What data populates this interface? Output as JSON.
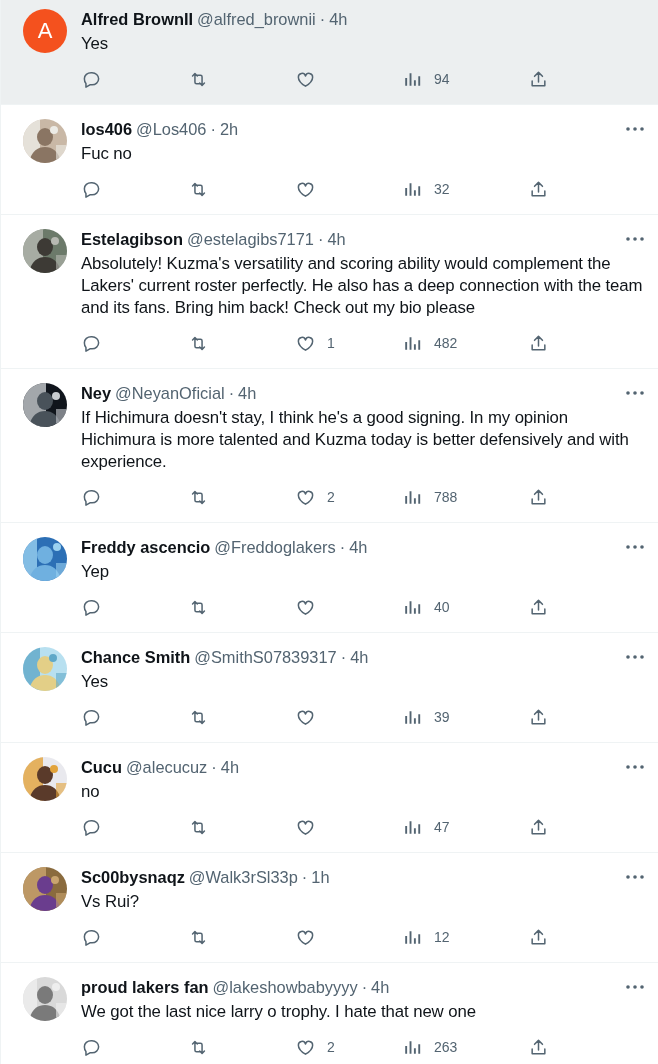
{
  "replies": [
    {
      "avatar": {
        "kind": "letter",
        "letter": "A"
      },
      "name": "Alfred BrownII",
      "handle": "@alfred_brownii",
      "separator": "·",
      "time": "4h",
      "text": "Yes",
      "views": "94",
      "highlighted": true,
      "menu": false
    },
    {
      "name": "los406",
      "handle": "@Los406",
      "separator": "·",
      "time": "2h",
      "text": "Fuc no",
      "views": "32",
      "highlighted": false,
      "menu": true
    },
    {
      "name": "Estelagibson",
      "handle": "@estelagibs7171",
      "separator": "·",
      "time": "4h",
      "text": "Absolutely! Kuzma's versatility and scoring ability would complement the Lakers' current roster perfectly. He also has a deep connection with the team and its fans. Bring him back! Check out my bio please",
      "likes": "1",
      "views": "482",
      "highlighted": false,
      "menu": true
    },
    {
      "name": "Ney",
      "handle": "@NeyanOficial",
      "separator": "·",
      "time": "4h",
      "text": "If Hichimura doesn't stay, I think he's a good signing. In my opinion Hichimura is more talented and Kuzma today is better defensively and with experience.",
      "likes": "2",
      "views": "788",
      "highlighted": false,
      "menu": true
    },
    {
      "name": "Freddy ascencio",
      "handle": "@Freddoglakers",
      "separator": "·",
      "time": "4h",
      "text": "Yep",
      "views": "40",
      "highlighted": false,
      "menu": true
    },
    {
      "name": "Chance Smith",
      "handle": "@SmithS07839317",
      "separator": "·",
      "time": "4h",
      "text": "Yes",
      "views": "39",
      "highlighted": false,
      "menu": true
    },
    {
      "name": "Cucu",
      "handle": "@alecucuz",
      "separator": "·",
      "time": "4h",
      "text": "no",
      "views": "47",
      "highlighted": false,
      "menu": true
    },
    {
      "name": "Sc00bysnaqz",
      "handle": "@Walk3rSl33p",
      "separator": "·",
      "time": "1h",
      "text": "Vs Rui?",
      "views": "12",
      "highlighted": false,
      "menu": true
    },
    {
      "name": "proud lakers fan",
      "handle": "@lakeshowbabyyyy",
      "separator": "·",
      "time": "4h",
      "text": "We got the last nice larry o trophy. I hate that new one",
      "likes": "2",
      "views": "263",
      "highlighted": false,
      "menu": true
    }
  ]
}
